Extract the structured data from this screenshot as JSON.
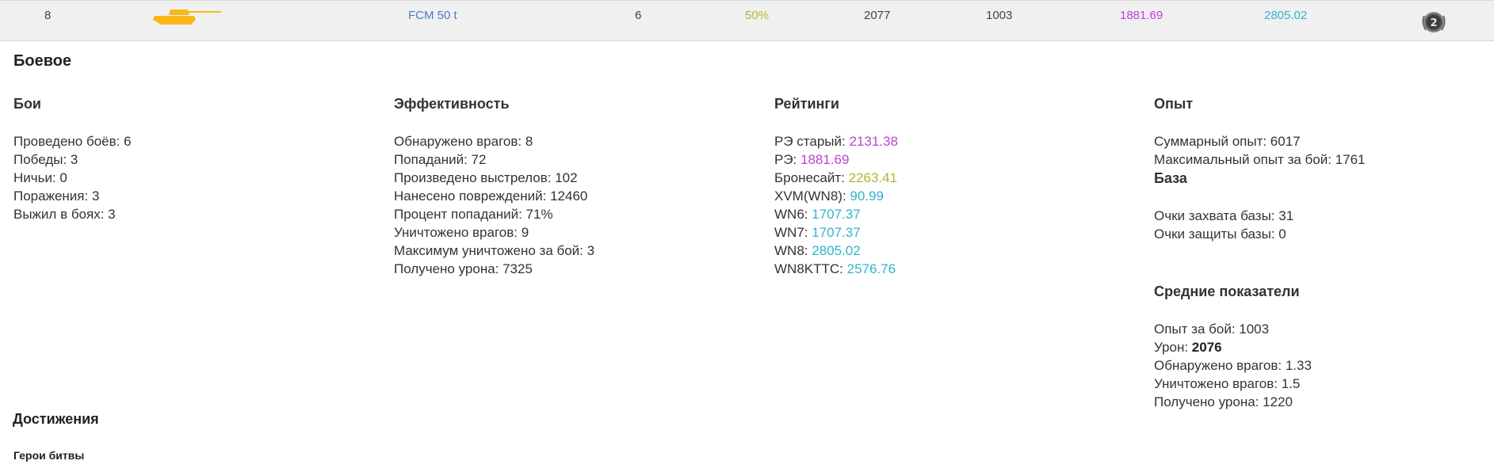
{
  "vehicle_row": {
    "rank": "8",
    "tank_icon": "tank-silhouette-icon",
    "tank_icon_color": "#f8b818",
    "tank_name": "FCM 50 t",
    "battles": "6",
    "win_rate": "50%",
    "avg_damage": "2077",
    "avg_xp": "1003",
    "eff_rating": "1881.69",
    "wn8": "2805.02",
    "mastery_badge_icon": "mastery-badge-2-icon",
    "mastery_level": "2"
  },
  "section_title": "Боевое",
  "battles_col": {
    "title": "Бои",
    "items": [
      "Проведено боёв: 6",
      "Победы: 3",
      "Ничьи: 0",
      "Поражения: 3",
      "Выжил в боях: 3"
    ]
  },
  "efficiency_col": {
    "title": "Эффективность",
    "items": [
      "Обнаружено врагов: 8",
      "Попаданий: 72",
      "Произведено выстрелов: 102",
      "Нанесено повреждений: 12460",
      "Процент попаданий: 71%",
      "Уничтожено врагов: 9",
      "Максимум уничтожено за бой: 3",
      "Получено урона: 7325"
    ]
  },
  "ratings_col": {
    "title": "Рейтинги",
    "items": [
      {
        "label": "РЭ старый: ",
        "value": "2131.38"
      },
      {
        "label": "РЭ: ",
        "value": "1881.69"
      },
      {
        "label": "Бронесайт: ",
        "value": "2263.41"
      },
      {
        "label": "XVM(WN8): ",
        "value": "90.99"
      },
      {
        "label": "WN6: ",
        "value": "1707.37"
      },
      {
        "label": "WN7: ",
        "value": "1707.37"
      },
      {
        "label": "WN8: ",
        "value": "2805.02"
      },
      {
        "label": "WN8KTTC: ",
        "value": "2576.76"
      }
    ]
  },
  "experience_col": {
    "title": "Опыт",
    "items": [
      "Суммарный опыт: 6017",
      "Максимальный опыт за бой: 1761"
    ]
  },
  "base_col": {
    "title": "База",
    "items": [
      "Очки захвата базы: 31",
      "Очки защиты базы: 0"
    ]
  },
  "averages_col": {
    "title": "Средние показатели",
    "xp_per_battle": "Опыт за бой: 1003",
    "damage_label": "Урон: ",
    "damage_value": "2076",
    "spotted": "Обнаружено врагов: 1.33",
    "destroyed": "Уничтожено врагов: 1.5",
    "received": "Получено урона: 1220"
  },
  "achievements": {
    "title": "Достижения",
    "subtitle": "Герои битвы"
  },
  "colors": {
    "link_blue": "#4a7cc4",
    "olive": "#b5b52e",
    "purple": "#c040d8",
    "cyan": "#33b3cc"
  }
}
